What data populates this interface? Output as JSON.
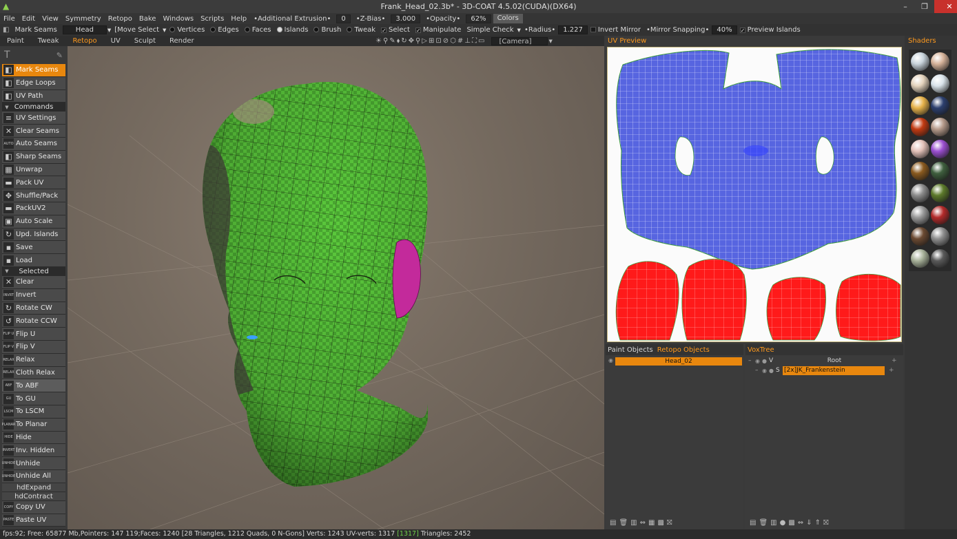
{
  "window": {
    "title": "Frank_Head_02.3b* - 3D-COAT 4.5.02(CUDA)(DX64)",
    "minimize": "–",
    "restore": "❐",
    "close": "✕"
  },
  "menu": {
    "items": [
      "File",
      "Edit",
      "View",
      "Symmetry",
      "Retopo",
      "Bake",
      "Windows",
      "Scripts",
      "Help"
    ],
    "additional_extrusion_label": "•Additional Extrusion•",
    "additional_extrusion_value": "0",
    "zbias_label": "•Z-Bias•",
    "zbias_value": "3.000",
    "opacity_label": "•Opacity•",
    "opacity_value": "62%",
    "colors_label": "Colors"
  },
  "toolbar": {
    "tool_label": "Mark Seams",
    "object_value": "Head",
    "move_select": "[Move Select",
    "vertices": "Vertices",
    "edges": "Edges",
    "faces": "Faces",
    "islands": "Islands",
    "brush": "Brush",
    "tweak": "Tweak",
    "select": "Select",
    "manipulate": "Manipulate",
    "simple_check": "Simple Check",
    "radius_label": "•Radius•",
    "radius_value": "1.227",
    "invert_mirror": "Invert Mirror",
    "mirror_snapping_label": "•Mirror Snapping•",
    "mirror_snapping_value": "40%",
    "preview_islands": "Preview Islands"
  },
  "rooms": [
    "Paint",
    "Tweak",
    "Retopo",
    "UV",
    "Sculpt",
    "Render"
  ],
  "active_room": "Retopo",
  "camera": "[Camera]",
  "left_panel": {
    "tools": [
      {
        "label": "Mark Seams",
        "icon": "◧",
        "state": "active"
      },
      {
        "label": "Edge Loops",
        "icon": "◧",
        "state": ""
      },
      {
        "label": "UV Path",
        "icon": "◧",
        "state": ""
      }
    ],
    "commands_title": "Commands",
    "commands": [
      {
        "label": "UV Settings",
        "icon": "≡"
      },
      {
        "label": "Clear Seams",
        "icon": "✕"
      },
      {
        "label": "Auto Seams",
        "icon": "AUTO"
      },
      {
        "label": "Sharp Seams",
        "icon": "◧"
      },
      {
        "label": "Unwrap",
        "icon": "▦"
      },
      {
        "label": "Pack UV",
        "icon": "▬"
      },
      {
        "label": "Shuffle/Pack",
        "icon": "✥"
      },
      {
        "label": "PackUV2",
        "icon": "▬"
      },
      {
        "label": "Auto Scale",
        "icon": "▣"
      },
      {
        "label": "Upd. Islands",
        "icon": "↻"
      },
      {
        "label": "Save",
        "icon": "▪"
      },
      {
        "label": "Load",
        "icon": "▪"
      }
    ],
    "selected_title": "Selected",
    "selected": [
      {
        "label": "Clear",
        "icon": "✕",
        "state": ""
      },
      {
        "label": "Invert",
        "icon": "INVRT",
        "state": ""
      },
      {
        "label": "Rotate  CW",
        "icon": "↻",
        "state": ""
      },
      {
        "label": "Rotate  CCW",
        "icon": "↺",
        "state": ""
      },
      {
        "label": "Flip  U",
        "icon": "FLIP U",
        "state": ""
      },
      {
        "label": "Flip  V",
        "icon": "FLIP V",
        "state": ""
      },
      {
        "label": "Relax",
        "icon": "RELAX",
        "state": ""
      },
      {
        "label": "Cloth  Relax",
        "icon": "RELAX",
        "state": ""
      },
      {
        "label": "To  ABF",
        "icon": "ABF",
        "state": "hover"
      },
      {
        "label": "To  GU",
        "icon": "GU",
        "state": ""
      },
      {
        "label": "To  LSCM",
        "icon": "LSCM",
        "state": ""
      },
      {
        "label": "To  Planar",
        "icon": "PLANAR",
        "state": ""
      },
      {
        "label": "Hide",
        "icon": "HIDE",
        "state": ""
      },
      {
        "label": "Inv.  Hidden",
        "icon": "INVERT",
        "state": ""
      },
      {
        "label": "Unhide",
        "icon": "UNHIDE",
        "state": ""
      },
      {
        "label": "Unhide  All",
        "icon": "UNHIDE",
        "state": ""
      }
    ],
    "hd_expand": "hdExpand",
    "hd_contract": "hdContract",
    "copy_paste": [
      {
        "label": "Copy  UV",
        "icon": "COPY"
      },
      {
        "label": "Paste  UV",
        "icon": "PASTE"
      }
    ]
  },
  "uv_preview": {
    "title": "UV Preview"
  },
  "shaders": {
    "title": "Shaders",
    "colors": [
      "#c9d4dc",
      "#d6b39a",
      "#e4d3bd",
      "#d9e3ea",
      "#e6b24a",
      "#2c3f6e",
      "#c23a12",
      "#b59a8a",
      "#e3c1b8",
      "#9b4fd0",
      "#8a5a1f",
      "#3f5f3e",
      "#8c8c8c",
      "#5d7a2b",
      "#9a9a9a",
      "#b32a2a",
      "#6b4a32",
      "#8f8f8f",
      "#a8b29a",
      "#5a5a5a"
    ]
  },
  "objects_panel": {
    "tab1": "Paint  Objects",
    "tab2": "Retopo  Objects",
    "object": "Head_02"
  },
  "voxtree": {
    "title": "VoxTree",
    "root_flag": "V",
    "root": "Root",
    "child_flag": "S",
    "child": "[2x]JK_Frankenstein",
    "add": "+"
  },
  "status": {
    "fps": "fps:92;",
    "text": "Free: 65877 Mb,Pointers: 147 119;Faces: 1240  [28  Triangles,  1212  Quads,  0  N-Gons]  Verts: 1243     UV-verts: 1317",
    "uv_hl": "[1317]",
    "tris": "Triangles: 2452"
  }
}
